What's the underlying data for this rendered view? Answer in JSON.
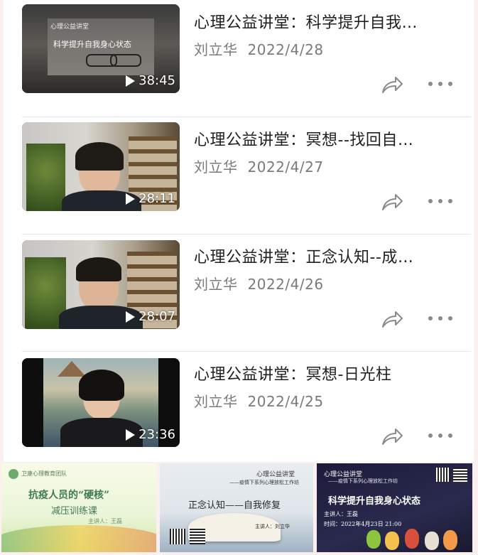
{
  "videos": [
    {
      "title": "心理公益讲堂：科学提升自我…",
      "author": "刘立华",
      "date": "2022/4/28",
      "duration": "38:45",
      "thumb_text": {
        "line1": "心理公益讲堂",
        "line2": "科学提升自我身心状态"
      }
    },
    {
      "title": "心理公益讲堂：冥想--找回自…",
      "author": "刘立华",
      "date": "2022/4/27",
      "duration": "28:11"
    },
    {
      "title": "心理公益讲堂：正念认知--成…",
      "author": "刘立华",
      "date": "2022/4/26",
      "duration": "28:07"
    },
    {
      "title": "心理公益讲堂：冥想-日光柱",
      "author": "刘立华",
      "date": "2022/4/25",
      "duration": "23:36"
    }
  ],
  "bottom_tiles": [
    {
      "org": "卫康心理教育团队",
      "title": "抗疫人员的“硬核”",
      "subtitle": "减压训练课",
      "note": "主讲人：王磊"
    },
    {
      "header1": "心理公益讲堂",
      "header2": "——疫情下系列心理放松工作坊",
      "title": "正念认知——自我修复",
      "speaker": "主讲人：刘立华"
    },
    {
      "header1": "心理公益讲堂",
      "header2": "——疫情下系列心理放松工作坊",
      "title": "科学提升自我身心状态",
      "speaker": "主讲人：王磊",
      "time": "时间：2022年4月23日 21:00"
    }
  ],
  "icons": {
    "share": "share-arrow-icon",
    "more": "more-dots-icon",
    "play": "play-icon"
  },
  "colors": {
    "background": "#fbeff0",
    "card": "#ffffff",
    "title": "#1f1f1f",
    "meta": "#7a7a7a"
  }
}
